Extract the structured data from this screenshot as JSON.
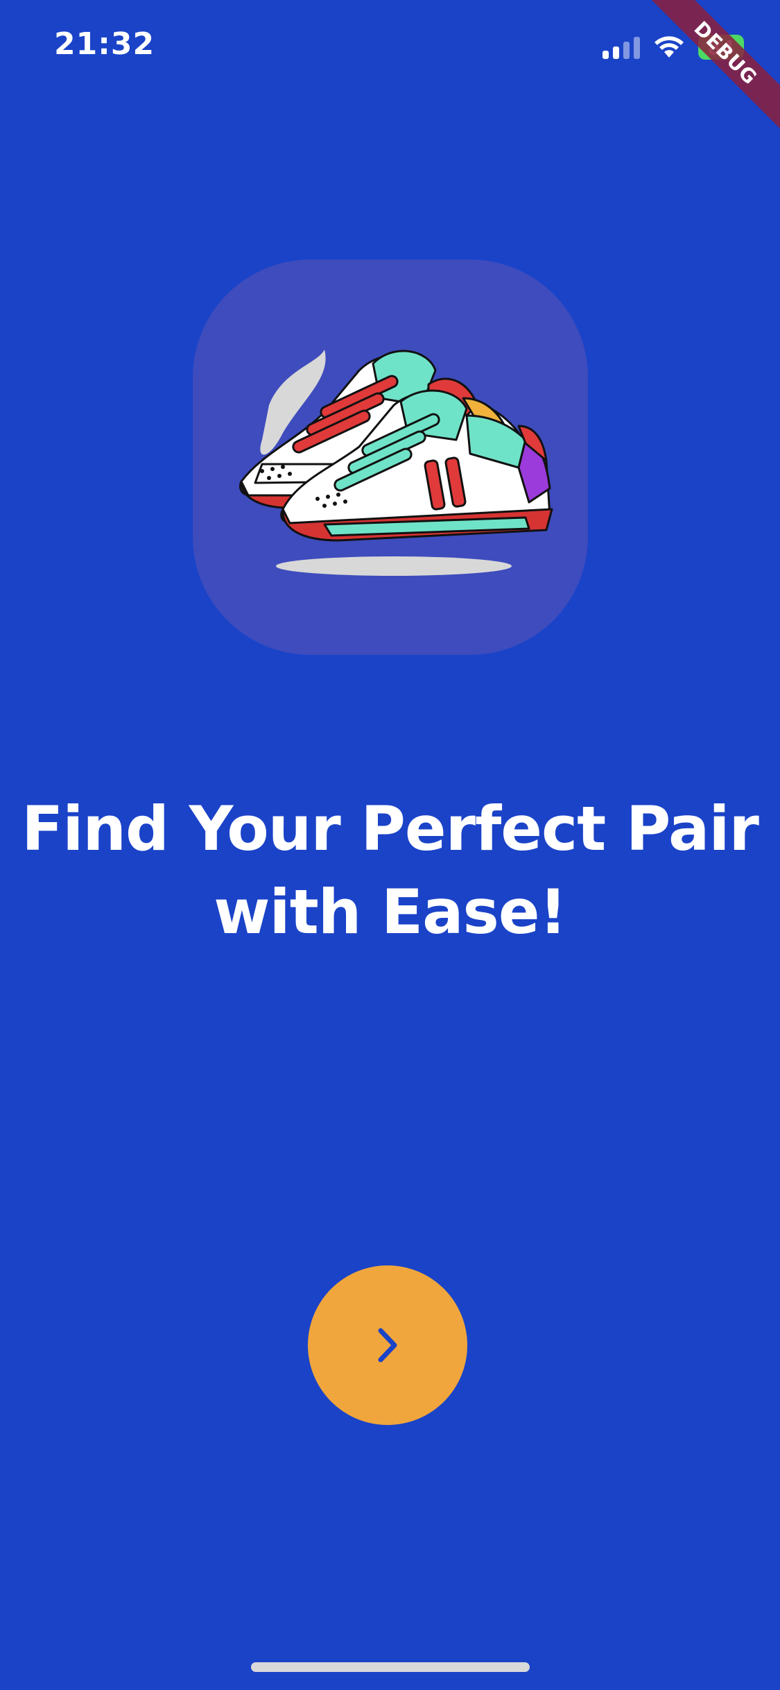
{
  "status_bar": {
    "time": "21:32",
    "battery": "84",
    "debug_banner": "DEBUG"
  },
  "logo": {
    "icon": "sneaker-icon"
  },
  "onboarding": {
    "headline_line1": "Find Your Perfect Pair",
    "headline_line2": "with Ease!"
  },
  "next_button": {
    "icon": "chevron-right-icon"
  },
  "colors": {
    "background": "#1a43c8",
    "card": "#3e4cbd",
    "button": "#f0a63c",
    "chevron": "#1a43c8"
  }
}
